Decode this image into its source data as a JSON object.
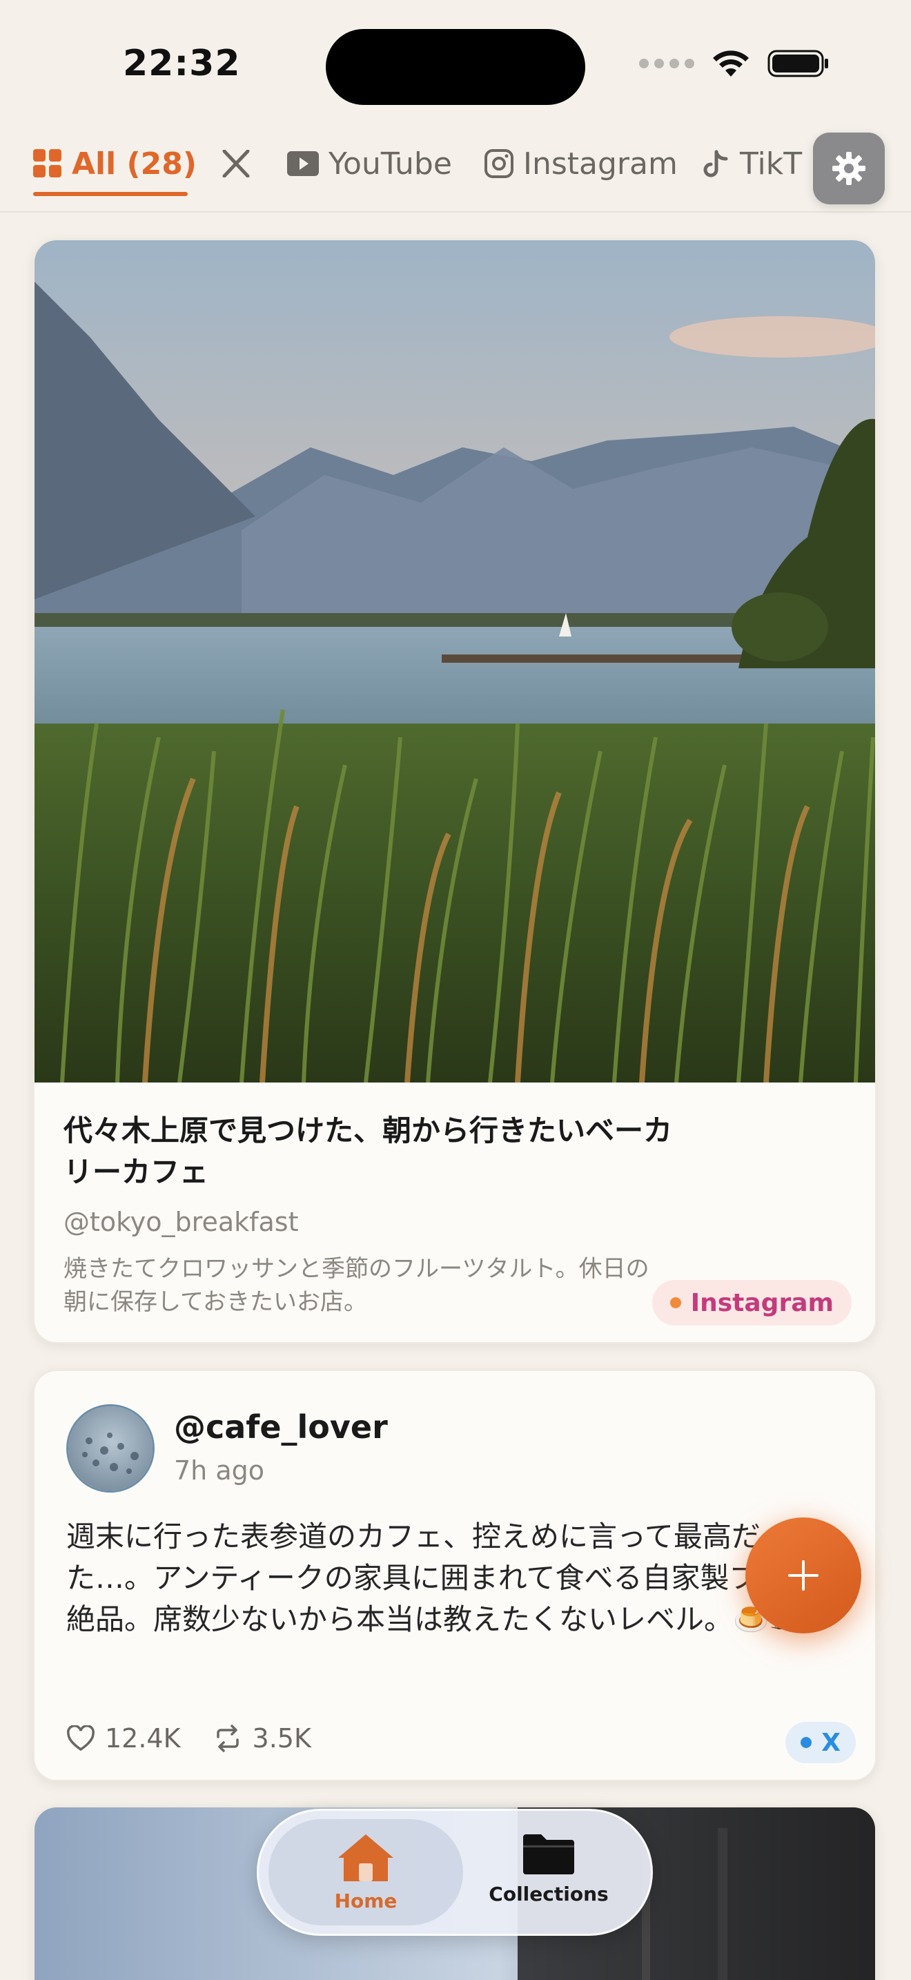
{
  "status_bar": {
    "time": "22:32"
  },
  "tabs": [
    {
      "label": "All (28)",
      "active": true,
      "icon": "grid-icon"
    },
    {
      "label": "X",
      "active": false,
      "icon": "x-logo-icon"
    },
    {
      "label": "YouTube",
      "active": false,
      "icon": "youtube-icon"
    },
    {
      "label": "Instagram",
      "active": false,
      "icon": "instagram-icon"
    },
    {
      "label": "TikT",
      "active": false,
      "icon": "tiktok-icon"
    }
  ],
  "cards": [
    {
      "type": "instagram",
      "title": "代々木上原で見つけた、朝から行きたいベーカリーカフェ",
      "handle": "@tokyo_breakfast",
      "description": "焼きたてクロワッサンと季節のフルーツタルト。休日の朝に保存しておきたいお店。",
      "platform": "Instagram"
    },
    {
      "type": "x",
      "user": "@cafe_lover",
      "time": "7h ago",
      "text": "週末に行った表参道のカフェ、控えめに言って最高だった…。アンティークの家具に囲まれて食べる自家製プリンが絶品。席数少ないから本当は教えたくないレベル。🍮☕",
      "likes": "12.4K",
      "reposts": "3.5K",
      "platform": "X"
    }
  ],
  "nav": {
    "home": "Home",
    "collections": "Collections"
  },
  "colors": {
    "accent": "#e0672a",
    "background": "#f5f1ea",
    "instagram": "#c43b7d",
    "x": "#2b8de0"
  }
}
